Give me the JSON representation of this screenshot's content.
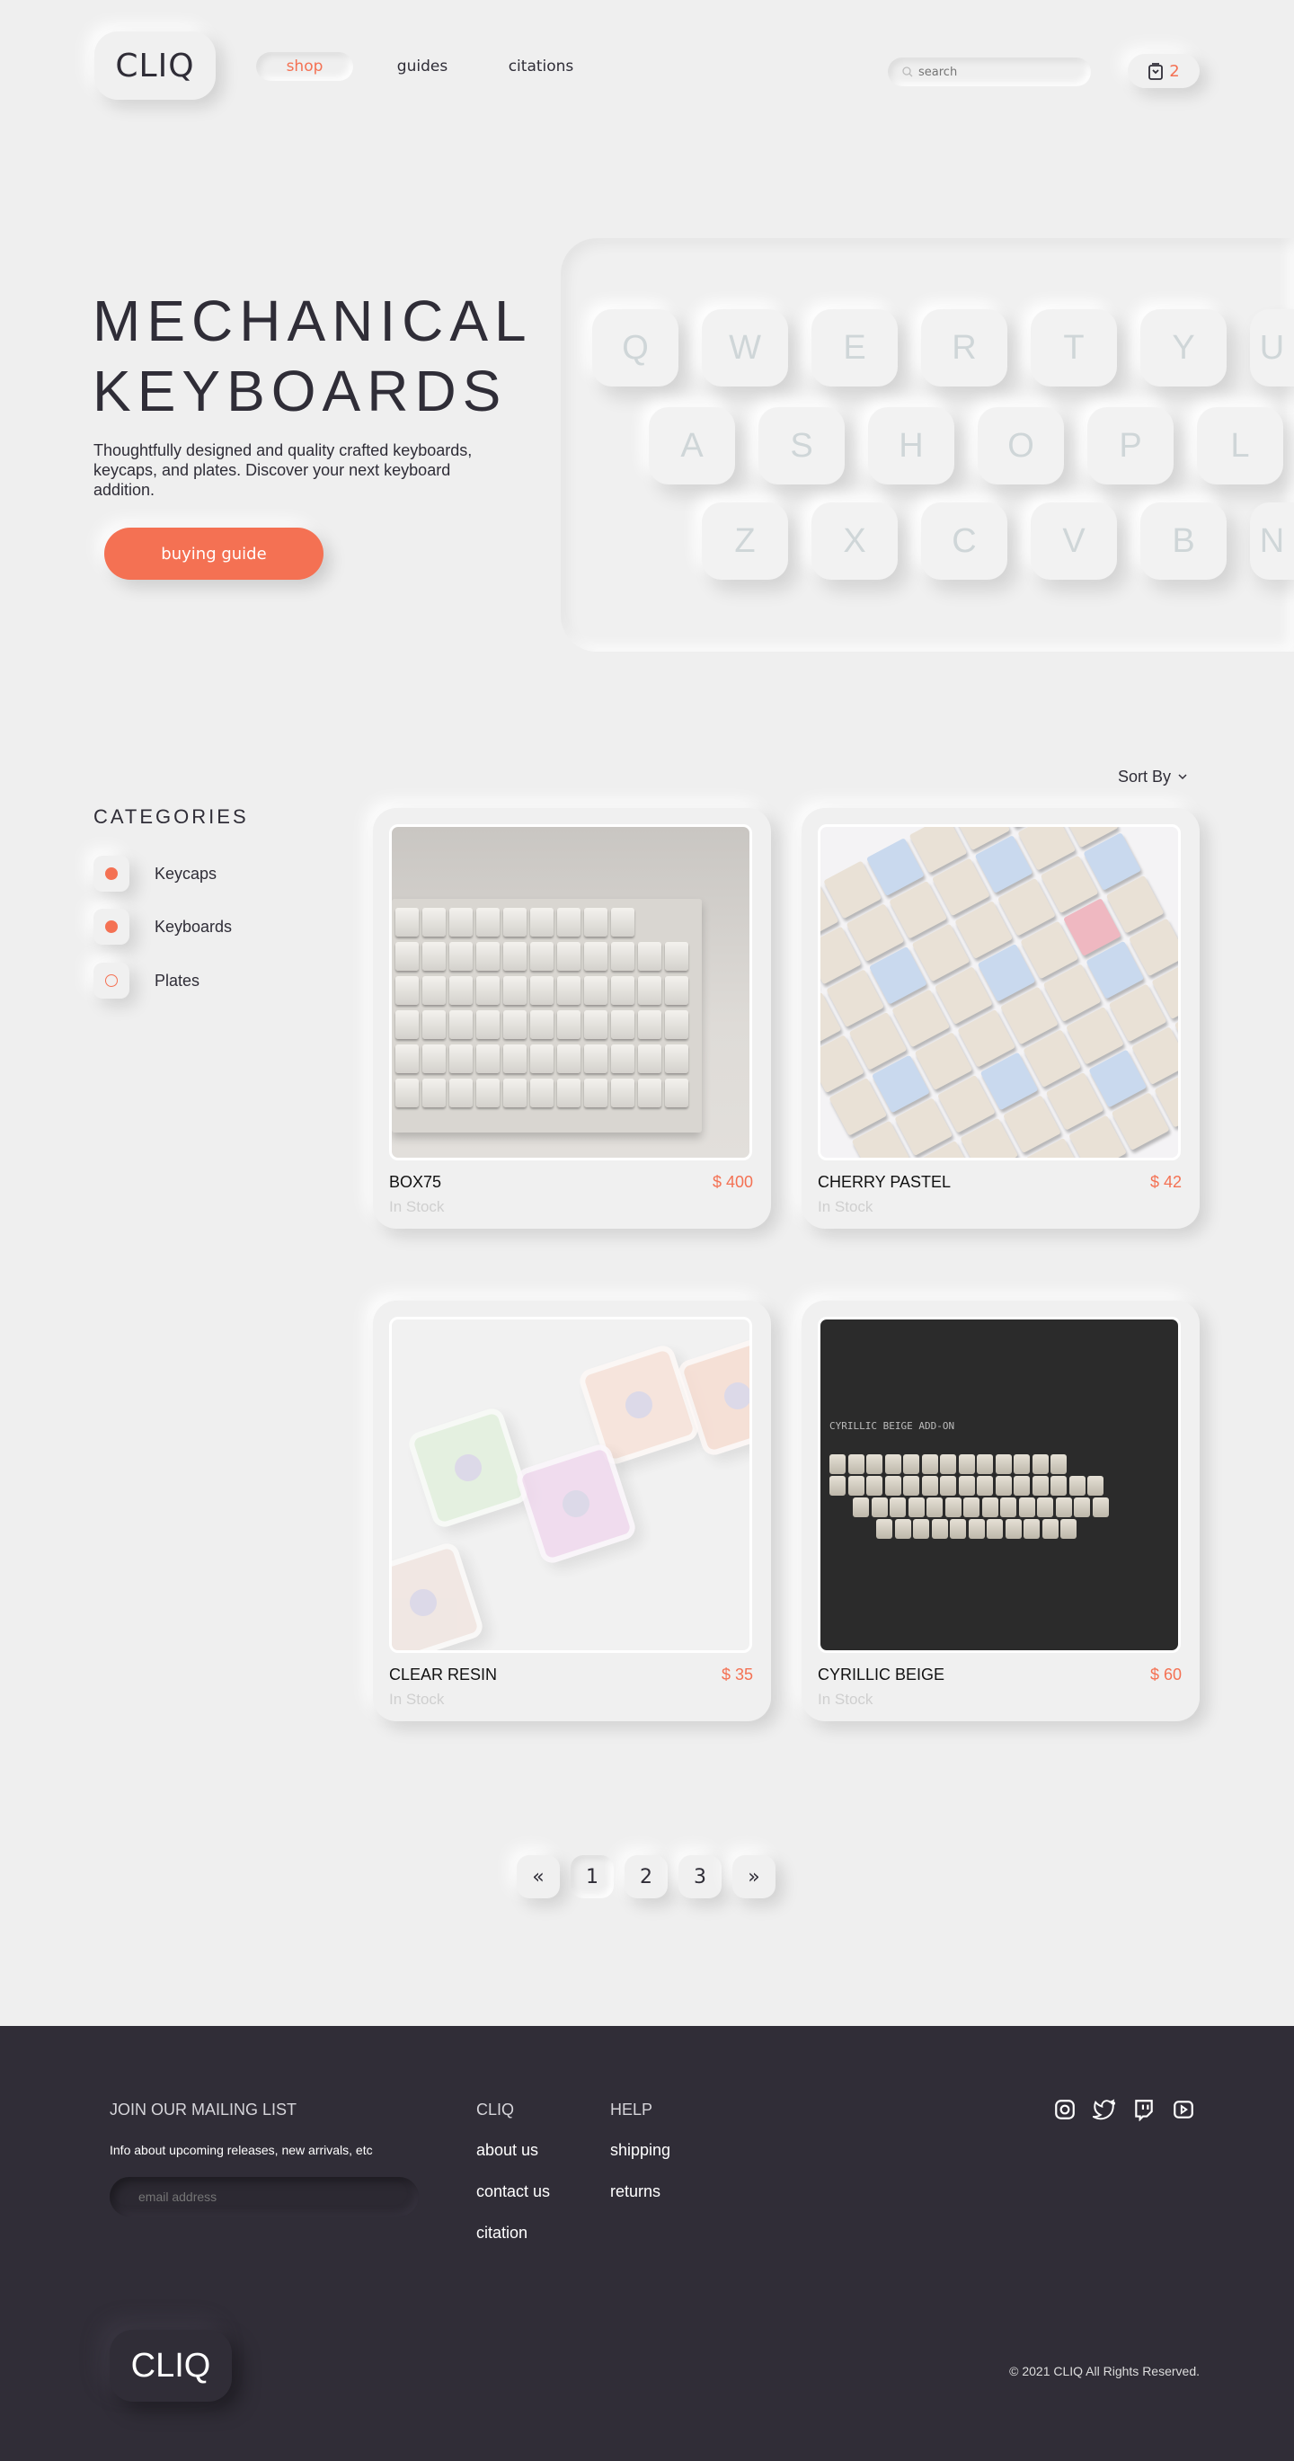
{
  "header": {
    "logo": "CLIQ",
    "nav": [
      {
        "label": "shop",
        "active": true
      },
      {
        "label": "guides"
      },
      {
        "label": "citations"
      }
    ],
    "search_placeholder": "search",
    "cart_count": "2",
    "cart_icon": "shopping-bag-icon"
  },
  "hero": {
    "title_line1": "MECHANICAL",
    "title_line2": "KEYBOARDS",
    "description": "Thoughtfully designed and quality crafted keyboards, keycaps, and plates. Discover your next keyboard addition.",
    "button": "buying guide",
    "key_rows": [
      [
        "Q",
        "W",
        "E",
        "R",
        "T",
        "Y",
        "U"
      ],
      [
        "A",
        "S",
        "H",
        "O",
        "P",
        "L"
      ],
      [
        "Z",
        "X",
        "C",
        "V",
        "B",
        "N"
      ]
    ]
  },
  "shop": {
    "sort_label": "Sort By",
    "categories_title": "CATEGORIES",
    "categories": [
      {
        "label": "Keycaps",
        "checked": true
      },
      {
        "label": "Keyboards",
        "checked": true
      },
      {
        "label": "Plates",
        "checked": false
      }
    ],
    "products": [
      {
        "name": "BOX75",
        "price": "$ 400",
        "stock": "In Stock"
      },
      {
        "name": "CHERRY PASTEL",
        "price": "$ 42",
        "stock": "In Stock"
      },
      {
        "name": "CLEAR RESIN",
        "price": "$ 35",
        "stock": "In Stock"
      },
      {
        "name": "CYRILLIC BEIGE",
        "price": "$ 60",
        "stock": "In Stock",
        "image_caption": "CYRILLIC BEIGE ADD-ON"
      }
    ],
    "pagination": {
      "prev": "«",
      "pages": [
        "1",
        "2",
        "3"
      ],
      "current": "1",
      "next": "»"
    }
  },
  "footer": {
    "mailing_title": "JOIN OUR MAILING LIST",
    "mailing_desc": "Info about upcoming releases, new arrivals, etc",
    "email_placeholder": "email address",
    "col1_title": "CLIQ",
    "col1_links": [
      "about us",
      "contact us",
      "citation"
    ],
    "col2_title": "HELP",
    "col2_links": [
      "shipping",
      "returns"
    ],
    "social": [
      "instagram-icon",
      "twitter-icon",
      "twitch-icon",
      "youtube-icon"
    ],
    "logo": "CLIQ",
    "copyright": "© 2021 CLIQ All Rights Reserved."
  },
  "colors": {
    "accent": "#f47153",
    "background": "#efefef",
    "footer": "#302d37",
    "text": "#2f2d37"
  }
}
